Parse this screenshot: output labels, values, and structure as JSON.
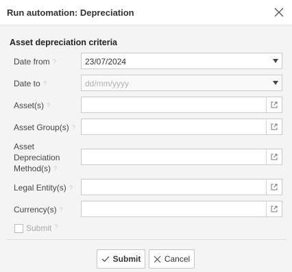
{
  "dialog": {
    "title": "Run automation: Depreciation"
  },
  "section": {
    "title": "Asset depreciation criteria"
  },
  "fields": {
    "date_from": {
      "label": "Date from",
      "value": "23/07/2024"
    },
    "date_to": {
      "label": "Date to",
      "placeholder": "dd/mm/yyyy"
    },
    "assets": {
      "label": "Asset(s)"
    },
    "asset_groups": {
      "label": "Asset Group(s)"
    },
    "depr_method": {
      "label_line1": "Asset",
      "label_line2": "Depreciation",
      "label_line3": "Method(s)"
    },
    "legal_entity": {
      "label": "Legal Entity(s)"
    },
    "currency": {
      "label": "Currency(s)"
    }
  },
  "hint_glyph": "?",
  "submit_checkbox": {
    "label": "Submit",
    "checked": false
  },
  "buttons": {
    "submit": "Submit",
    "cancel": "Cancel"
  },
  "icons": {
    "close": "close-icon",
    "dropdown": "chevron-down-icon",
    "lookup": "external-link-icon",
    "check": "check-icon",
    "cancel": "x-icon"
  }
}
